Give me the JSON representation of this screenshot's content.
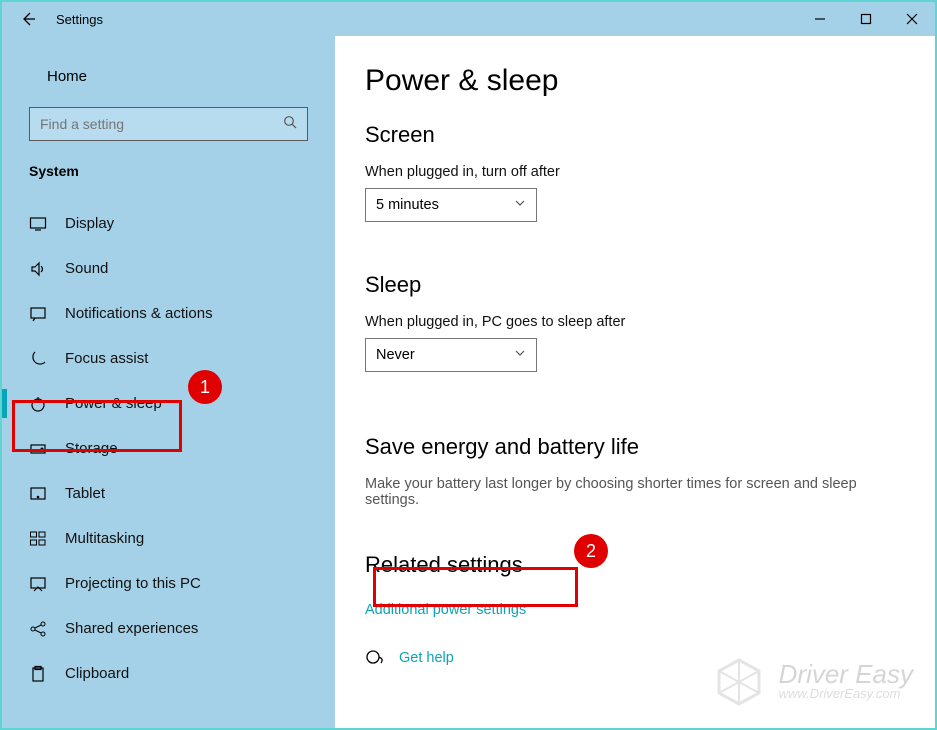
{
  "titlebar": {
    "title": "Settings"
  },
  "sidebar": {
    "home_label": "Home",
    "search_placeholder": "Find a setting",
    "section_label": "System",
    "items": [
      {
        "label": "Display"
      },
      {
        "label": "Sound"
      },
      {
        "label": "Notifications & actions"
      },
      {
        "label": "Focus assist"
      },
      {
        "label": "Power & sleep",
        "active": true
      },
      {
        "label": "Storage"
      },
      {
        "label": "Tablet"
      },
      {
        "label": "Multitasking"
      },
      {
        "label": "Projecting to this PC"
      },
      {
        "label": "Shared experiences"
      },
      {
        "label": "Clipboard"
      }
    ]
  },
  "content": {
    "page_title": "Power & sleep",
    "screen_heading": "Screen",
    "screen_label": "When plugged in, turn off after",
    "screen_value": "5 minutes",
    "sleep_heading": "Sleep",
    "sleep_label": "When plugged in, PC goes to sleep after",
    "sleep_value": "Never",
    "energy_heading": "Save energy and battery life",
    "energy_sub": "Make your battery last longer by choosing shorter times for screen and sleep settings.",
    "related_heading": "Related settings",
    "additional_link": "Additional power settings",
    "help_link": "Get help"
  },
  "annotations": {
    "badge1": "1",
    "badge2": "2"
  },
  "watermark": {
    "brand": "Driver Easy",
    "url": "www.DriverEasy.com"
  }
}
